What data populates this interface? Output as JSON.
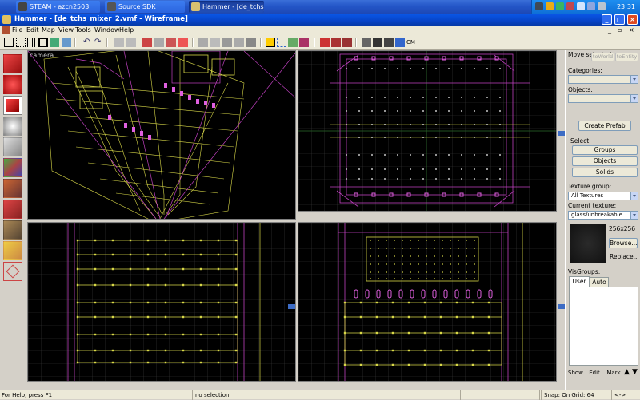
{
  "taskbar": {
    "tasks": [
      {
        "label": "STEAM - azcn2503",
        "active": false
      },
      {
        "label": "Source SDK",
        "active": false
      },
      {
        "label": "Hammer - [de_tchs_...",
        "active": true
      }
    ],
    "clock": "23:31"
  },
  "window": {
    "title": "Hammer - [de_tchs_mixer_2.vmf - Wireframe]",
    "minimize": "_",
    "maximize": "□",
    "close": "×"
  },
  "menu": {
    "items": [
      "File",
      "Edit",
      "Map",
      "View",
      "Tools",
      "Window",
      "Help"
    ],
    "doc_controls": [
      "_",
      "▫",
      "×"
    ]
  },
  "toolbar": {
    "cm_label": "CM"
  },
  "viewports": {
    "camera_label": "camera"
  },
  "right_panel": {
    "move_selected": "Move selected:",
    "to_world": "toWorld",
    "to_entity": "toEntity",
    "categories_label": "Categories:",
    "objects_label": "Objects:",
    "create_prefab": "Create Prefab",
    "select_label": "Select:",
    "groups": "Groups",
    "objects": "Objects",
    "solids": "Solids",
    "texture_group_label": "Texture group:",
    "texture_group_value": "All Textures",
    "current_texture_label": "Current texture:",
    "current_texture_value": "glass/unbreakable",
    "texture_size": "256x256",
    "browse": "Browse...",
    "replace": "Replace...",
    "visgroups_label": "VisGroups:",
    "visgroup_tabs": [
      "User",
      "Auto"
    ],
    "show": "Show",
    "edit": "Edit",
    "mark": "Mark"
  },
  "status": {
    "help": "For Help, press F1",
    "selection": "no selection.",
    "grid": "Snap: On Grid: 64",
    "arrows": "<->"
  },
  "colors": {
    "wire_yellow": "#d8d848",
    "wire_magenta": "#c040c0",
    "grid": "#3a3a3a",
    "accent": "#3d6cc4"
  }
}
